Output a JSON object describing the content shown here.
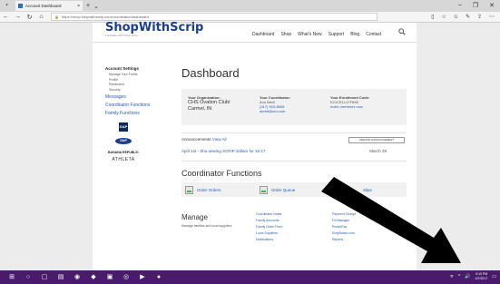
{
  "browser": {
    "tab_title": "Account Dashboard",
    "tab_close": "×",
    "new_tab": "+",
    "tab_menu": "⌄",
    "address": "https://shop.shopwithscrip.com/coordinator/dashboard",
    "win_min": "–",
    "win_max": "❐",
    "win_close": "✕"
  },
  "site": {
    "logo": "ShopWithScrip",
    "logo_sub": "Fundraise with Great Scrip",
    "nav": [
      "Dashboard",
      "Shop",
      "What's New",
      "Support",
      "Blog",
      "Contact"
    ]
  },
  "sidebar": {
    "account_settings": "Account Settings",
    "account_items": [
      "Manage Your Profile",
      "Profile",
      "Reminders",
      "Security"
    ],
    "links": [
      "Messages",
      "Coordinator Functions",
      "Family Functions"
    ],
    "brands": {
      "square": "GAP",
      "oval": "GAP",
      "text": "BANANA REPUBLIC",
      "athleta": "ATHLETA"
    }
  },
  "main": {
    "title": "Dashboard",
    "org_label": "Your Organization:",
    "org_value": "CHS Ovation Club/ Carmel, IN",
    "coord_label": "Your Coordinator:",
    "coord_name": "Ann Brett",
    "coord_phone": "(317) 903-8655",
    "coord_email": "abrett@aol.com",
    "enroll_label": "Your Enrollment Code:",
    "enroll_value": "E21CE1L47F898",
    "enroll_link": "Invite members now",
    "announcements": "Announcements",
    "view_all": "View All",
    "ann_button": "CREATE ANNOUNCEMENT",
    "ann_item": "April 1st - Sho-sewing SCRIP dollars for 16-17",
    "ann_date": "March 28",
    "coordinator_functions": "Coordinator Functions",
    "cf_buttons": [
      "Order Orders",
      "Order Queue",
      "Slips"
    ],
    "manage": "Manage",
    "manage_desc": "Manage families and local suppliers",
    "manage_col1": [
      "Coordinator Notes",
      "Family Accounts",
      "Family Order Form",
      "Local Suppliers",
      "Notifications"
    ],
    "manage_col2": [
      "Payment Charge",
      "Fill Manager",
      "PrestoPay",
      "ScripNotes.com",
      "Reports"
    ]
  },
  "taskbar": {
    "icons": [
      "⊞",
      "○",
      "▢",
      "▤",
      "◉",
      "◆",
      "▣",
      "◎",
      "▶",
      "●"
    ],
    "tray": [
      "ᯤ",
      "^",
      "🔊"
    ],
    "time": "9:10 PM",
    "date": "4/7/2017"
  }
}
